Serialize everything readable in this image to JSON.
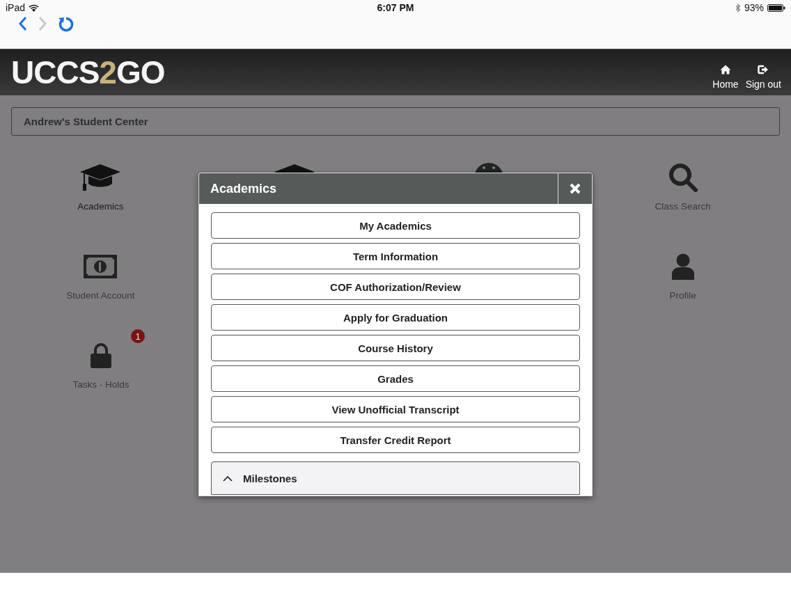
{
  "status_bar": {
    "device": "iPad",
    "time": "6:07 PM",
    "battery": "93%"
  },
  "browser_nav": [
    {
      "kind": "back",
      "disabled": false
    },
    {
      "kind": "forward",
      "disabled": true
    },
    {
      "kind": "reload",
      "disabled": false
    }
  ],
  "header": {
    "logo": {
      "text_start": "UCCS",
      "accent": "2",
      "text_end": "GO"
    },
    "actions": [
      {
        "kind": "home",
        "label": "Home"
      },
      {
        "kind": "signout",
        "label": "Sign out"
      }
    ]
  },
  "page_title": "Andrew's Student Center",
  "tile_rows": [
    [
      {
        "kind": "cap",
        "label": "Academics"
      },
      {
        "kind": "cap"
      },
      {
        "kind": "face"
      },
      {
        "kind": "search",
        "label": "Class Search"
      }
    ],
    [
      {
        "kind": "money",
        "label": "Student Account"
      },
      {},
      {},
      {
        "kind": "person",
        "label": "Profile"
      }
    ],
    [
      {
        "kind": "lock",
        "label": "Tasks - Holds",
        "badge": "1"
      }
    ]
  ],
  "modal": {
    "title": "Academics",
    "items": [
      "My Academics",
      "Term Information",
      "COF Authorization/Review",
      "Apply for Graduation",
      "Course History",
      "Grades",
      "View Unofficial Transcript",
      "Transfer Credit Report"
    ],
    "section": {
      "label": "Milestones",
      "expanded": true
    }
  }
}
